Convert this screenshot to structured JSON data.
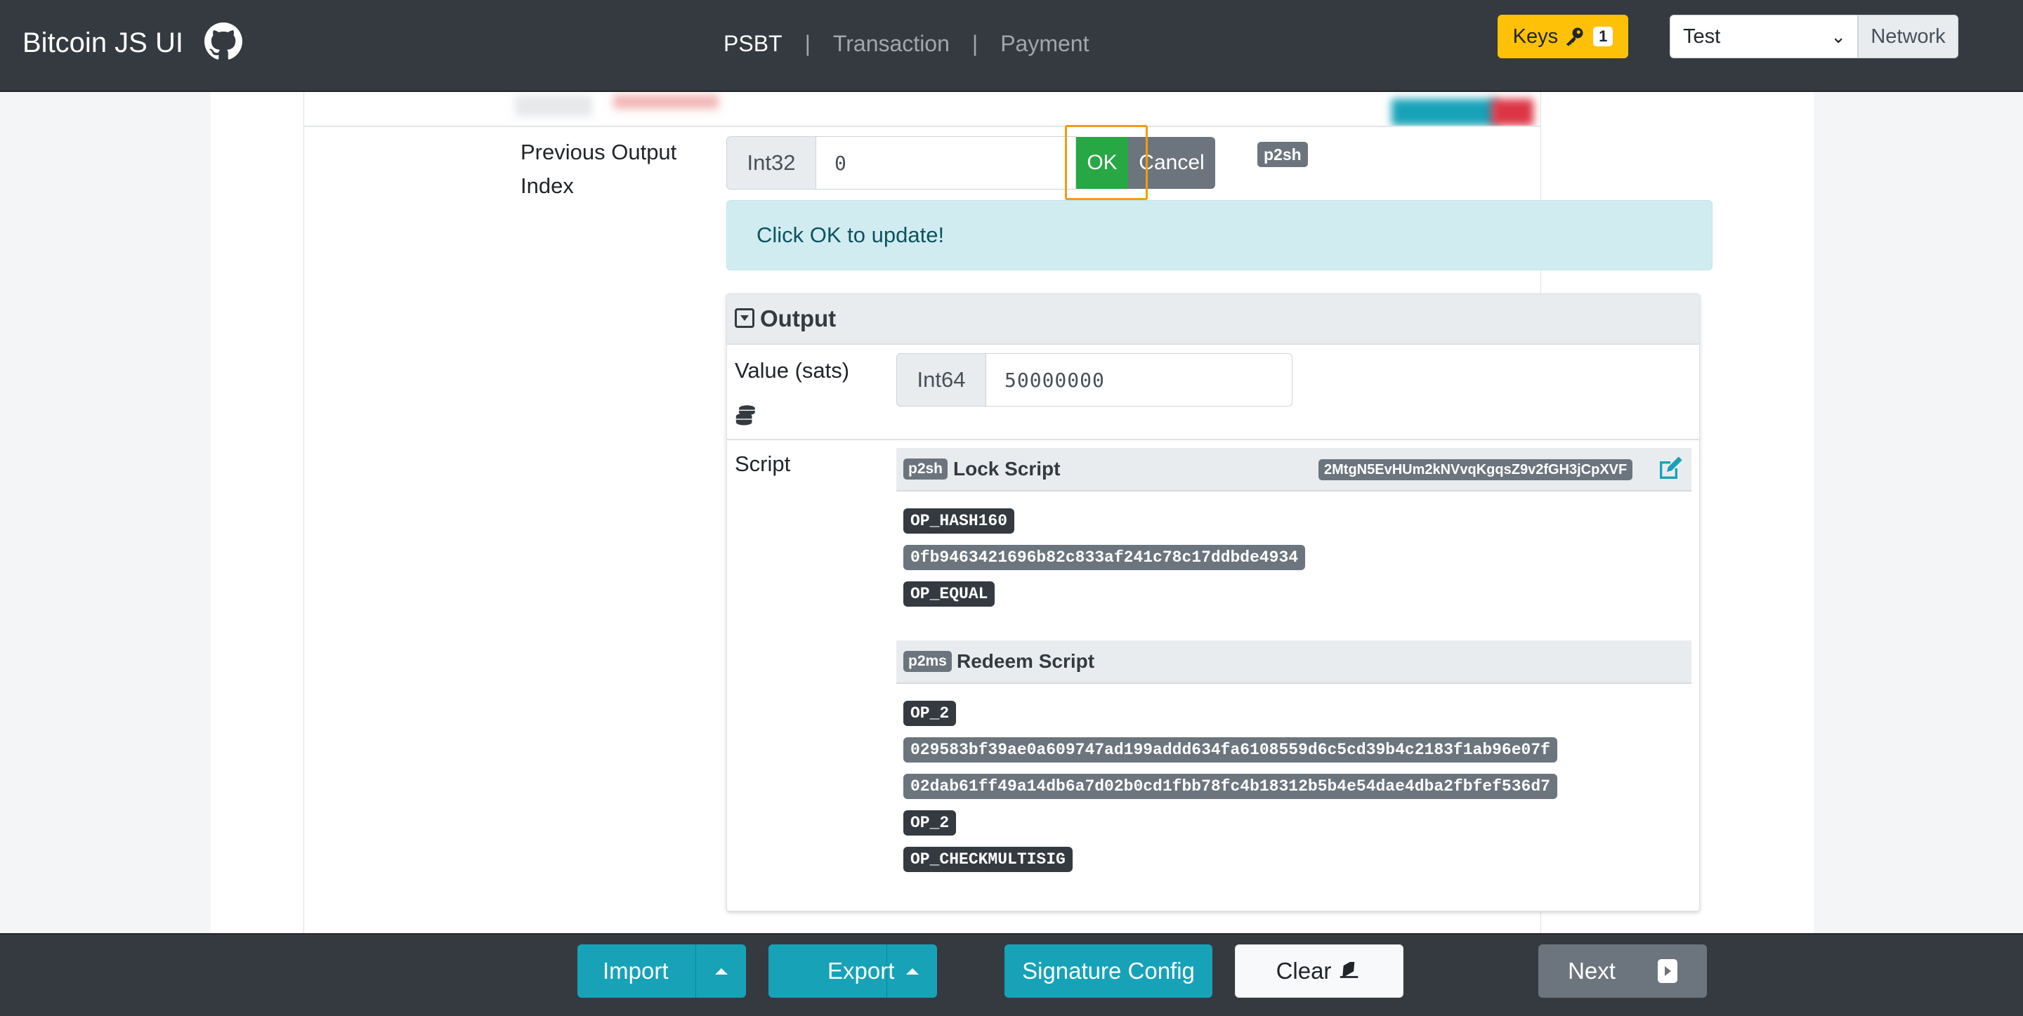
{
  "navbar": {
    "brand": "Bitcoin JS UI",
    "links": [
      {
        "label": "PSBT",
        "active": true
      },
      {
        "label": "Transaction",
        "active": false
      },
      {
        "label": "Payment",
        "active": false
      }
    ],
    "separator": "|",
    "keys": {
      "label": "Keys",
      "count": "1"
    },
    "network": {
      "selected": "Test",
      "label": "Network"
    }
  },
  "input_row": {
    "label": "Previous Output Index",
    "type_prefix": "Int32",
    "value": "0",
    "ok_label": "OK",
    "cancel_label": "Cancel",
    "script_type_badge": "p2sh",
    "alert": "Click OK to update!"
  },
  "output": {
    "title": "Output",
    "value_label": "Value (sats)",
    "value_prefix": "Int64",
    "value": "50000000",
    "script_label": "Script",
    "lock_script": {
      "badge": "p2sh",
      "title": "Lock Script",
      "address": "2MtgN5EvHUm2kNVvqKgqsZ9v2fGH3jCpXVF",
      "ops": [
        {
          "text": "OP_HASH160",
          "kind": "opcode"
        },
        {
          "text": "0fb9463421696b82c833af241c78c17ddbde4934",
          "kind": "data"
        },
        {
          "text": "OP_EQUAL",
          "kind": "opcode"
        }
      ]
    },
    "redeem_script": {
      "badge": "p2ms",
      "title": "Redeem Script",
      "ops": [
        {
          "text": "OP_2",
          "kind": "opcode"
        },
        {
          "text": "029583bf39ae0a609747ad199addd634fa6108559d6c5cd39b4c2183f1ab96e07f",
          "kind": "data"
        },
        {
          "text": "02dab61ff49a14db6a7d02b0cd1fbb78fc4b18312b5b4e54dae4dba2fbfef536d7",
          "kind": "data"
        },
        {
          "text": "OP_2",
          "kind": "opcode"
        },
        {
          "text": "OP_CHECKMULTISIG",
          "kind": "opcode"
        }
      ]
    }
  },
  "footer": {
    "import_label": "Import",
    "export_label": "Export",
    "signature_config_label": "Signature Config",
    "clear_label": "Clear",
    "next_label": "Next"
  },
  "colors": {
    "navbar": "#343a40",
    "info": "#17a2b8",
    "success": "#28a745",
    "secondary": "#6c757d",
    "warning": "#ffc107",
    "highlight": "#f39c12"
  }
}
